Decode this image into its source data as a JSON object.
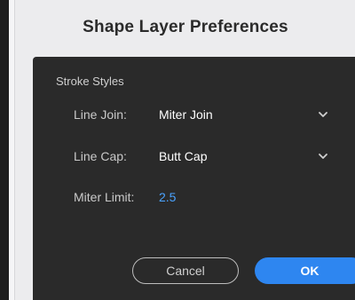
{
  "dialog": {
    "title": "Shape Layer Preferences",
    "group_label": "Stroke Styles",
    "line_join": {
      "label": "Line Join:",
      "value": "Miter Join"
    },
    "line_cap": {
      "label": "Line Cap:",
      "value": "Butt Cap"
    },
    "miter_limit": {
      "label": "Miter Limit:",
      "value": "2.5"
    },
    "cancel_label": "Cancel",
    "ok_label": "OK"
  },
  "colors": {
    "panel": "#2a2a2a",
    "accent": "#2e86f0",
    "value_blue": "#4aa3ff"
  }
}
